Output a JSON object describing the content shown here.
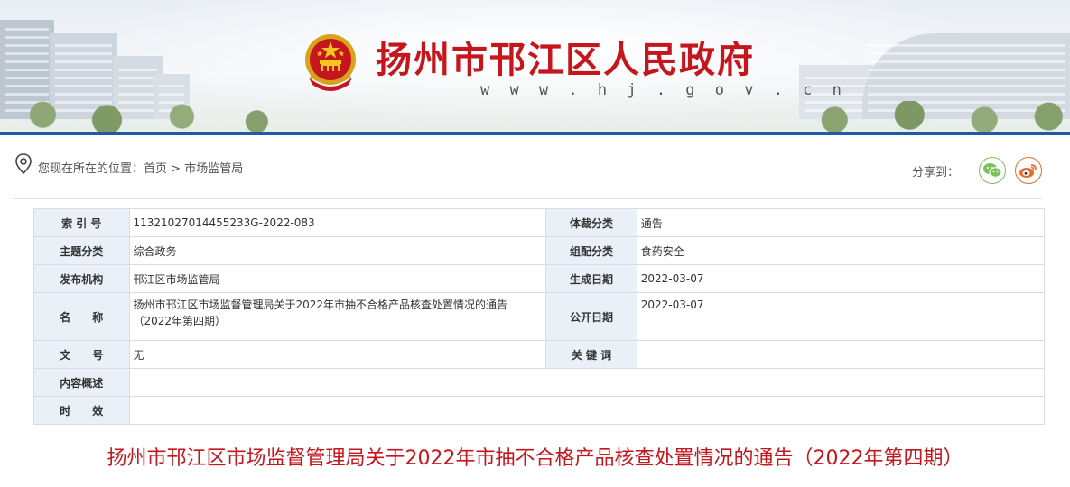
{
  "header": {
    "title": "扬州市邗江区人民政府",
    "url": "w w w . h j . g o v . c n"
  },
  "breadcrumb": {
    "prefix": "您现在所在的位置：",
    "home": "首页",
    "sep": " > ",
    "current": "市场监管局"
  },
  "share": {
    "label": "分享到：",
    "icons": [
      "wechat-icon",
      "weibo-icon"
    ]
  },
  "info_table": {
    "index_label": "索 引 号",
    "index_value": "11321027014455233G-2022-083",
    "genre_label": "体裁分类",
    "genre_value": "通告",
    "topic_label": "主题分类",
    "topic_value": "综合政务",
    "org_class_label": "组配分类",
    "org_class_value": "食药安全",
    "publisher_label": "发布机构",
    "publisher_value": "邗江区市场监管局",
    "created_label": "生成日期",
    "created_value": "2022-03-07",
    "name_label": "名　　称",
    "name_value": "扬州市邗江区市场监督管理局关于2022年市抽不合格产品核查处置情况的通告（2022年第四期）",
    "public_label": "公开日期",
    "public_value": "2022-03-07",
    "docno_label": "文　　号",
    "docno_value": "无",
    "keywords_label": "关 键 词",
    "keywords_value": "",
    "summary_label": "内容概述",
    "summary_value": "",
    "validity_label": "时　　效",
    "validity_value": ""
  },
  "article": {
    "title": "扬州市邗江区市场监督管理局关于2022年市抽不合格产品核查处置情况的通告（2022年第四期）"
  },
  "colors": {
    "brand_red": "#c4161c",
    "banner_bar": "#1f5aa6",
    "label_bg": "#eaf0f8"
  }
}
